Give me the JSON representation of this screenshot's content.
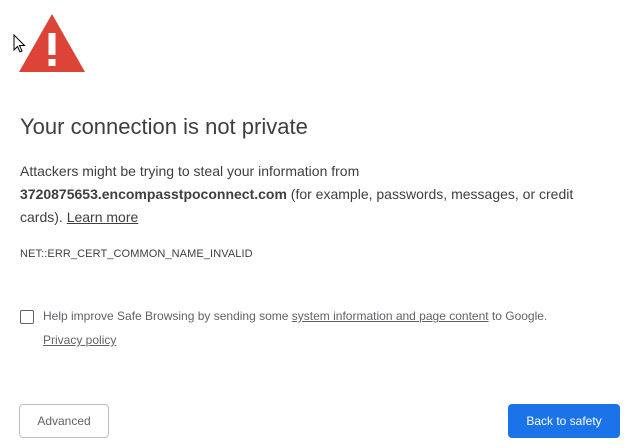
{
  "icon": {
    "name": "warning-triangle-icon",
    "color": "#db4437"
  },
  "heading": "Your connection is not private",
  "message": {
    "before_host": "Attackers might be trying to steal your information from ",
    "host": "3720875653.encompasstpoconnect.com",
    "after_host": " (for example, passwords, messages, or credit cards). ",
    "learn_more": "Learn more"
  },
  "error_code": "NET::ERR_CERT_COMMON_NAME_INVALID",
  "safe_browsing": {
    "checked": false,
    "text_before": "Help improve Safe Browsing by sending some ",
    "link_text": "system information and page content",
    "text_after": " to Google.",
    "privacy_policy": "Privacy policy"
  },
  "buttons": {
    "advanced": "Advanced",
    "back_to_safety": "Back to safety"
  },
  "colors": {
    "accent": "#1a73e8",
    "warning": "#db4437",
    "text": "#3c4043"
  }
}
